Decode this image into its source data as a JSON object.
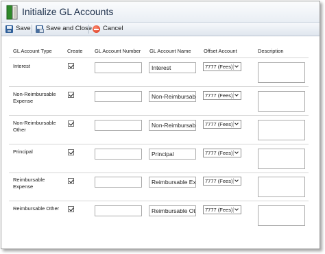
{
  "window": {
    "title": "Initialize GL Accounts",
    "icon": "book-icon"
  },
  "toolbar": {
    "save_label": "Save",
    "save_close_label": "Save and Close",
    "cancel_label": "Cancel"
  },
  "columns": {
    "type": "GL Account Type",
    "create": "Create",
    "number": "GL Account Number",
    "name": "GL Account Name",
    "offset": "Offset Account",
    "description": "Description"
  },
  "rows": [
    {
      "type": "Interest",
      "create": true,
      "number": "",
      "name": "Interest",
      "offset": "7777 (Fees)",
      "description": ""
    },
    {
      "type": "Non-Reimbursable Expense",
      "create": true,
      "number": "",
      "name": "Non-Reimbursab",
      "offset": "7777 (Fees)",
      "description": ""
    },
    {
      "type": "Non-Reimbursable Other",
      "create": true,
      "number": "",
      "name": "Non-Reimbursab",
      "offset": "7777 (Fees)",
      "description": ""
    },
    {
      "type": "Principal",
      "create": true,
      "number": "",
      "name": "Principal",
      "offset": "7777 (Fees)",
      "description": ""
    },
    {
      "type": "Reimbursable Expense",
      "create": true,
      "number": "",
      "name": "Reimbursable Ex",
      "offset": "7777 (Fees)",
      "description": ""
    },
    {
      "type": "Reimbursable Other",
      "create": true,
      "number": "",
      "name": "Reimbursable Oth",
      "offset": "7777 (Fees)",
      "description": ""
    }
  ]
}
